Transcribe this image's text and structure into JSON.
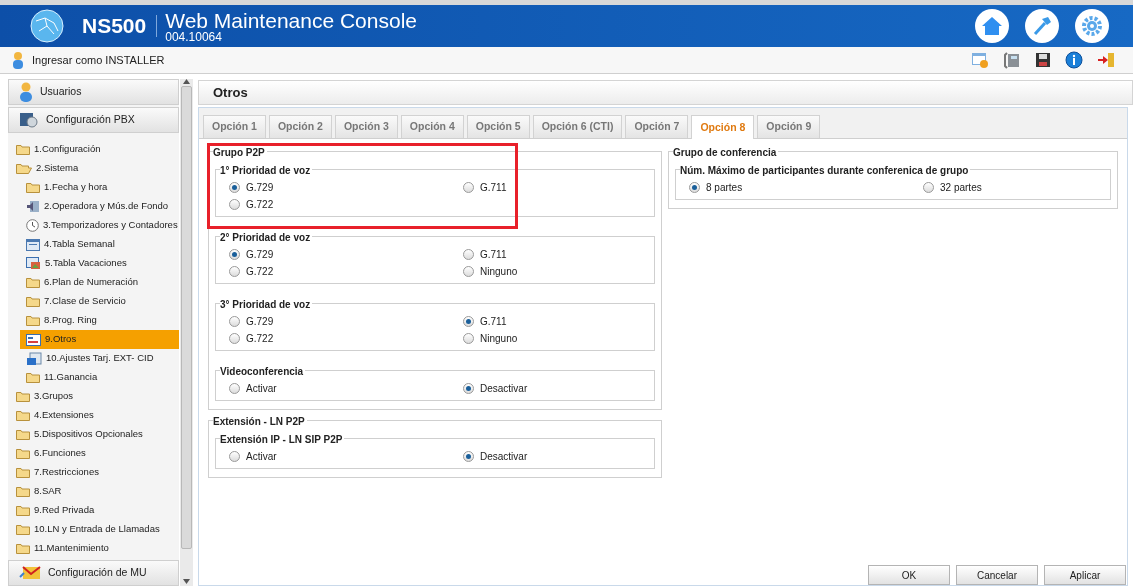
{
  "header": {
    "product": "NS500",
    "title": "Web Maintenance Console",
    "version": "004.10064"
  },
  "user_bar": {
    "label": "Ingresar como INSTALLER"
  },
  "sidebar": {
    "sections_top": [
      {
        "label": "Usuarios",
        "kind": "user"
      },
      {
        "label": "Configuración PBX",
        "kind": "pbx"
      }
    ],
    "tree": [
      {
        "label": "1.Configuración",
        "expanded": false
      },
      {
        "label": "2.Sistema",
        "expanded": true,
        "children": [
          {
            "label": "1.Fecha y hora",
            "kind": "folder",
            "selected": false
          },
          {
            "label": "2.Operadora y Mús.de Fondo",
            "kind": "speaker",
            "selected": false
          },
          {
            "label": "3.Temporizadores y Contadores",
            "kind": "clock",
            "selected": false
          },
          {
            "label": "4.Tabla Semanal",
            "kind": "window",
            "selected": false
          },
          {
            "label": "5.Tabla Vacaciones",
            "kind": "picture",
            "selected": false
          },
          {
            "label": "6.Plan de Numeración",
            "kind": "folder",
            "selected": false
          },
          {
            "label": "7.Clase de Servicio",
            "kind": "folder",
            "selected": false
          },
          {
            "label": "8.Prog. Ring",
            "kind": "folder",
            "selected": false
          },
          {
            "label": "9.Otros",
            "kind": "form",
            "selected": true
          },
          {
            "label": "10.Ajustes Tarj. EXT- CID",
            "kind": "card",
            "selected": false
          },
          {
            "label": "11.Ganancia",
            "kind": "folder",
            "selected": false
          }
        ]
      },
      {
        "label": "3.Grupos",
        "expanded": false
      },
      {
        "label": "4.Extensiones",
        "expanded": false
      },
      {
        "label": "5.Dispositivos Opcionales",
        "expanded": false
      },
      {
        "label": "6.Funciones",
        "expanded": false
      },
      {
        "label": "7.Restricciones",
        "expanded": false
      },
      {
        "label": "8.SAR",
        "expanded": false
      },
      {
        "label": "9.Red Privada",
        "expanded": false
      },
      {
        "label": "10.LN y Entrada de Llamadas",
        "expanded": false
      },
      {
        "label": "11.Mantenimiento",
        "expanded": false
      }
    ],
    "sections_bottom": [
      {
        "label": "Configuración de MU",
        "kind": "mu"
      }
    ]
  },
  "page_title": "Otros",
  "tabs": [
    {
      "label": "Opción 1",
      "selected": false
    },
    {
      "label": "Opción 2",
      "selected": false
    },
    {
      "label": "Opción 3",
      "selected": false
    },
    {
      "label": "Opción 4",
      "selected": false
    },
    {
      "label": "Opción 5",
      "selected": false
    },
    {
      "label": "Opción 6 (CTI)",
      "selected": false
    },
    {
      "label": "Opción 7",
      "selected": false
    },
    {
      "label": "Opción 8",
      "selected": true
    },
    {
      "label": "Opción 9",
      "selected": false
    }
  ],
  "left_groups": [
    {
      "title": "Grupo P2P",
      "highlighted": true,
      "subgroups": [
        {
          "title": "1° Prioridad de voz",
          "options": [
            {
              "label": "G.729",
              "selected": true
            },
            {
              "label": "G.711",
              "selected": false
            },
            {
              "label": "G.722",
              "selected": false
            }
          ]
        },
        {
          "title": "2° Prioridad de voz",
          "options": [
            {
              "label": "G.729",
              "selected": true
            },
            {
              "label": "G.711",
              "selected": false
            },
            {
              "label": "G.722",
              "selected": false
            },
            {
              "label": "Ninguno",
              "selected": false
            }
          ]
        },
        {
          "title": "3° Prioridad de voz",
          "options": [
            {
              "label": "G.729",
              "selected": false
            },
            {
              "label": "G.711",
              "selected": true
            },
            {
              "label": "G.722",
              "selected": false
            },
            {
              "label": "Ninguno",
              "selected": false
            }
          ]
        },
        {
          "title": "Videoconferencia",
          "options": [
            {
              "label": "Activar",
              "selected": false
            },
            {
              "label": "Desactivar",
              "selected": true
            }
          ]
        }
      ]
    },
    {
      "title": "Extensión - LN P2P",
      "highlighted": false,
      "subgroups": [
        {
          "title": "Extensión IP - LN SIP P2P",
          "options": [
            {
              "label": "Activar",
              "selected": false
            },
            {
              "label": "Desactivar",
              "selected": true
            }
          ]
        }
      ]
    }
  ],
  "right_groups": [
    {
      "title": "Grupo de conferencia",
      "highlighted": false,
      "subgroups": [
        {
          "title": "Núm. Máximo de participantes durante conferenica de grupo",
          "options": [
            {
              "label": "8 partes",
              "selected": true
            },
            {
              "label": "32 partes",
              "selected": false
            }
          ]
        }
      ]
    }
  ],
  "buttons": [
    "OK",
    "Cancelar",
    "Aplicar"
  ]
}
